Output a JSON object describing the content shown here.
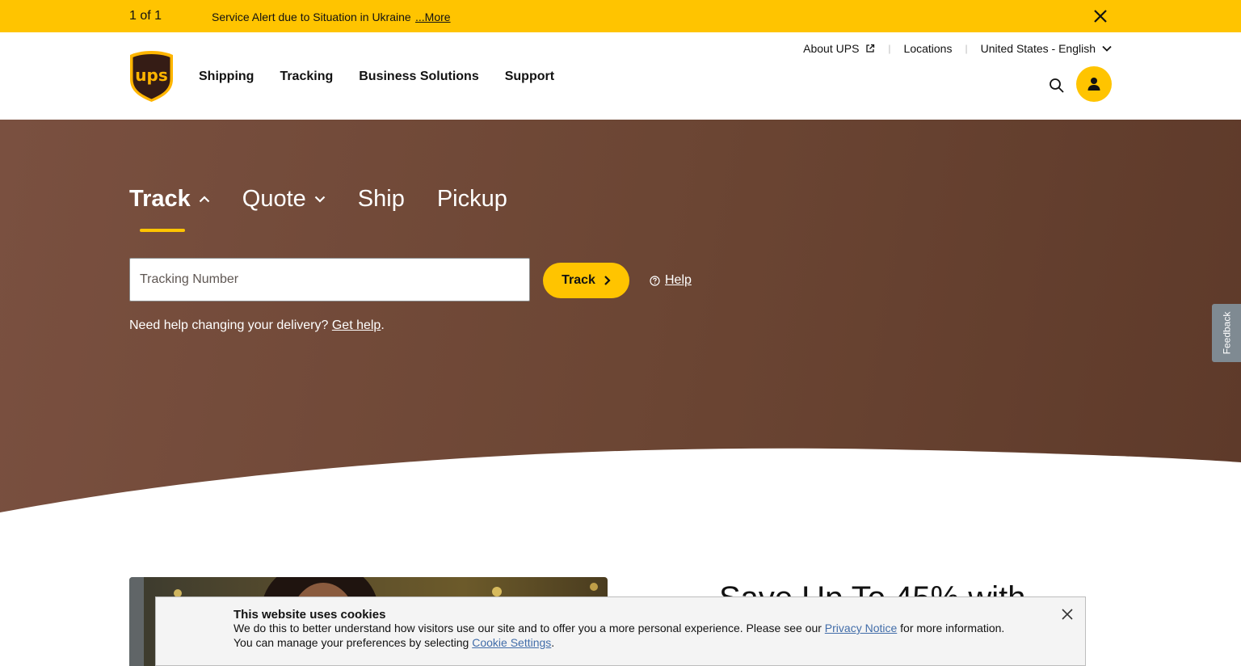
{
  "alert": {
    "count": "1 of 1",
    "message": "Service Alert due to Situation in Ukraine",
    "more_label": "...More"
  },
  "header": {
    "logo_text": "ups",
    "nav": [
      "Shipping",
      "Tracking",
      "Business Solutions",
      "Support"
    ],
    "utility": {
      "about": "About UPS",
      "locations": "Locations",
      "language": "United States - English"
    }
  },
  "hero": {
    "tabs": [
      "Track",
      "Quote",
      "Ship",
      "Pickup"
    ],
    "active_tab": "Track",
    "tracking_placeholder": "Tracking Number",
    "track_button": "Track",
    "help_label": "Help",
    "help_text": "Need help changing your delivery?",
    "get_help_label": "Get help",
    "period": "."
  },
  "feedback_label": "Feedback",
  "promo": {
    "title": "Save Up To 45% with"
  },
  "cookie": {
    "title": "This website uses cookies",
    "line1_pre": "We do this to better understand how visitors use our site and to offer you a more personal experience. Please see our",
    "privacy_link": "Privacy Notice",
    "line1_post": "for more information.",
    "line2_pre": "You can manage your preferences by selecting",
    "settings_link": "Cookie Settings",
    "line2_post": "."
  },
  "colors": {
    "brand_yellow": "#ffc400",
    "brand_brown": "#351c15",
    "hero_brown": "#6b4533",
    "link_blue": "#426da9"
  },
  "icons": [
    "close-icon",
    "ups-logo",
    "external-link-icon",
    "chevron-down-icon",
    "search-icon",
    "user-icon",
    "chevron-up-icon",
    "chevron-right-icon",
    "help-circle-icon"
  ]
}
